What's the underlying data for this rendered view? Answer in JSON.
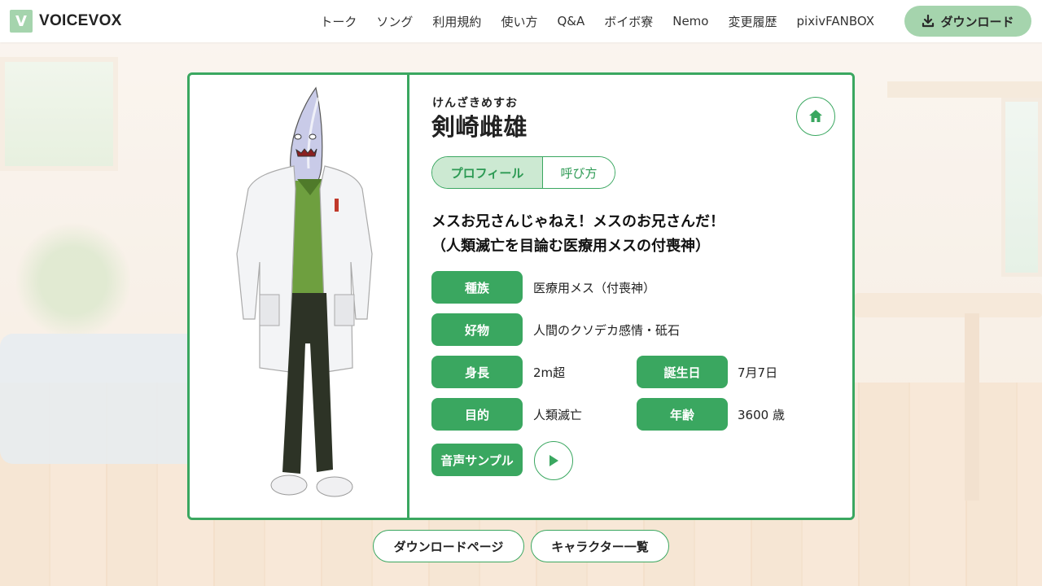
{
  "header": {
    "logo_mark": "V",
    "logo_text": "VOICEVOX",
    "nav": [
      "トーク",
      "ソング",
      "利用規約",
      "使い方",
      "Q&A",
      "ボイボ寮",
      "Nemo",
      "変更履歴",
      "pixivFANBOX"
    ],
    "download_label": "ダウンロード",
    "download_icon": "download-icon"
  },
  "character": {
    "ruby": "けんざきめすお",
    "name": "剣崎雌雄",
    "tabs": {
      "profile": "プロフィール",
      "calling": "呼び方"
    },
    "catchphrase_line1": "メスお兄さんじゃねえ！メスのお兄さんだ！",
    "catchphrase_line2": "（人類滅亡を目論む医療用メスの付喪神）",
    "profile": {
      "species_label": "種族",
      "species_value": "医療用メス（付喪神）",
      "likes_label": "好物",
      "likes_value": "人間のクソデカ感情・砥石",
      "height_label": "身長",
      "height_value": "2m超",
      "birthday_label": "誕生日",
      "birthday_value": "7月7日",
      "purpose_label": "目的",
      "purpose_value": "人類滅亡",
      "age_label": "年齢",
      "age_value": "3600 歳",
      "sample_label": "音声サンプル"
    }
  },
  "footer_buttons": {
    "download_page": "ダウンロードページ",
    "character_list": "キャラクター一覧"
  },
  "colors": {
    "accent": "#3aa760",
    "accent_light": "#cce9d2",
    "header_button": "#a5d4ad"
  }
}
